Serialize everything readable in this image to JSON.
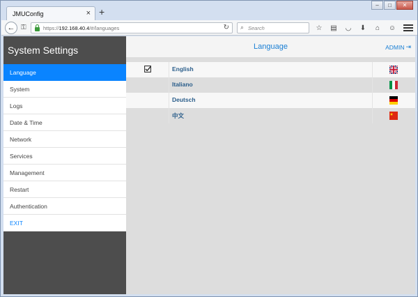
{
  "browser": {
    "tab_title": "JMUConfig",
    "tab_close": "×",
    "new_tab": "+",
    "url_prefix": "https://",
    "url_host": "192.168.40.4",
    "url_path": "/#/languages",
    "search_placeholder": "Search"
  },
  "app": {
    "sidebar_title": "System Settings",
    "header_title": "Language",
    "admin_label": "ADMIN",
    "menu": [
      {
        "label": "Language",
        "active": true
      },
      {
        "label": "System"
      },
      {
        "label": "Logs"
      },
      {
        "label": "Date & Time"
      },
      {
        "label": "Network"
      },
      {
        "label": "Services"
      },
      {
        "label": "Management"
      },
      {
        "label": "Restart"
      },
      {
        "label": "Authentication"
      },
      {
        "label": "EXIT"
      }
    ],
    "languages": [
      {
        "name": "English",
        "selected": true,
        "flag": "uk-flag-icon"
      },
      {
        "name": "Italiano",
        "selected": false,
        "flag": "italy-flag-icon"
      },
      {
        "name": "Deutsch",
        "selected": false,
        "flag": "germany-flag-icon"
      },
      {
        "name": "中文",
        "selected": false,
        "flag": "china-flag-icon"
      }
    ]
  },
  "colors": {
    "accent": "#0a84ff",
    "sidebar_bg": "#4d4d4d",
    "link": "#1a7fd4"
  }
}
